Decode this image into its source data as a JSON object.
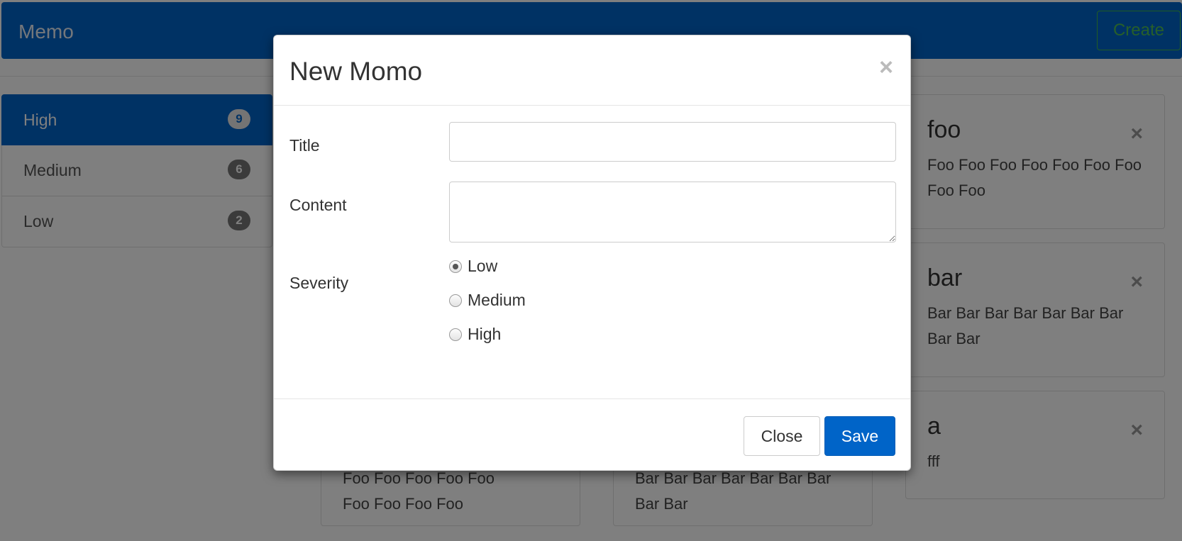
{
  "navbar": {
    "brand": "Memo",
    "create_label": "Create"
  },
  "sidebar": {
    "items": [
      {
        "label": "High",
        "count": "9",
        "active": true
      },
      {
        "label": "Medium",
        "count": "6",
        "active": false
      },
      {
        "label": "Low",
        "count": "2",
        "active": false
      }
    ]
  },
  "cards": [
    {
      "title": "foo",
      "body": "Foo Foo Foo Foo Foo Foo Foo Foo Foo",
      "close": "×"
    },
    {
      "title": "bar",
      "body": "Bar Bar Bar Bar Bar Bar Bar Bar Bar",
      "close": "×"
    },
    {
      "title": "a",
      "body": "fff",
      "close": "×"
    },
    {
      "title": "",
      "body": "Foo Foo Foo Foo Foo Foo Foo Foo Foo",
      "close": ""
    },
    {
      "title": "",
      "body": "Bar Bar Bar Bar Bar Bar Bar Bar Bar",
      "close": ""
    }
  ],
  "modal": {
    "title": "New Momo",
    "close_icon": "×",
    "fields": {
      "title_label": "Title",
      "title_value": "",
      "content_label": "Content",
      "content_value": "",
      "severity_label": "Severity"
    },
    "severity_options": [
      {
        "label": "Low",
        "checked": true
      },
      {
        "label": "Medium",
        "checked": false
      },
      {
        "label": "High",
        "checked": false
      }
    ],
    "buttons": {
      "close": "Close",
      "save": "Save"
    }
  },
  "colors": {
    "primary": "#0064c8",
    "success": "#43b94b",
    "badge": "#777777"
  }
}
